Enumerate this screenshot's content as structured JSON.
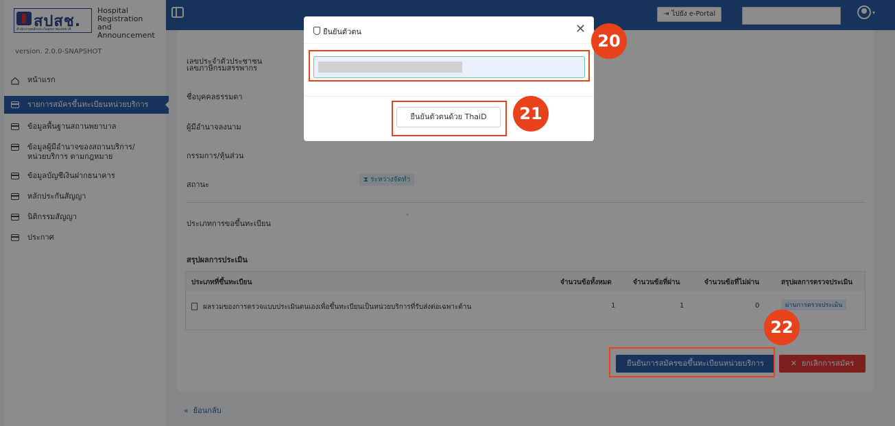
{
  "brand": {
    "logo_text": "สปสช.",
    "logo_subtitle": "สำนักงานหลักประกันสุขภาพแห่งชาติ",
    "name_line1": "Hospital",
    "name_line2": "Registration and",
    "name_line3": "Announcement",
    "version": "version. 2.0.0-SNAPSHOT"
  },
  "sidebar": {
    "items": [
      {
        "label": "หน้าแรก",
        "icon": "home-icon"
      },
      {
        "label": "รายการสมัครขึ้นทะเบียนหน่วยบริการ",
        "icon": "calendar-icon",
        "active": true
      },
      {
        "label": "ข้อมูลพื้นฐานสถานพยาบาล",
        "icon": "calendar-icon"
      },
      {
        "label": "ข้อมูลผู้มีอำนาจของสถานบริการ/หน่วยบริการ ตามกฎหมาย",
        "icon": "calendar-icon"
      },
      {
        "label": "ข้อมูลบัญชีเงินฝากธนาคาร",
        "icon": "calendar-icon"
      },
      {
        "label": "หลักประกันสัญญา",
        "icon": "calendar-icon"
      },
      {
        "label": "นิติกรรมสัญญา",
        "icon": "calendar-icon"
      },
      {
        "label": "ประกาศ",
        "icon": "calendar-icon"
      }
    ]
  },
  "topbar": {
    "portal_label": "ไปยัง e-Portal"
  },
  "form": {
    "fields": [
      "เลขประจำตัวประชาชน",
      "เลขภาษีกรมสรรพากร",
      "ชื่อบุคคลธรรมดา",
      "ผู้มีอำนาจลงนาม",
      "กรรมการ/หุ้นส่วน",
      "สถานะ"
    ],
    "status_value": "ระหว่างจัดทำ",
    "registration_type_label": "ประเภทการขอขึ้นทะเบียน",
    "registration_type_value": "-"
  },
  "summary": {
    "title": "สรุปผลการประเมิน",
    "columns": [
      "ประเภทที่ขึ้นทะเบียน",
      "จำนวนข้อทั้งหมด",
      "จำนวนข้อที่ผ่าน",
      "จำนวนข้อที่ไม่ผ่าน",
      "สรุปผลการตรวจประเมิน"
    ],
    "rows": [
      {
        "type": "ผลรวมของการตรวจแบบประเมินตนเองเพื่อขึ้นทะเบียนเป็นหน่วยบริการที่รับส่งต่อเฉพาะด้าน",
        "total": "1",
        "passed": "1",
        "failed": "0",
        "result": "ผ่านการตรวจประเมิน"
      }
    ]
  },
  "actions": {
    "confirm_label": "ยืนยันการสมัครขอขึ้นทะเบียนหน่วยบริการ",
    "cancel_label": "ยกเลิกการสมัคร",
    "back_label": "ย้อนกลับ"
  },
  "modal": {
    "title": "ยืนยันตัวตน",
    "thaid_label": "ยืนยันตัวตนด้วย ThaiD"
  },
  "annotations": [
    "20",
    "21",
    "22"
  ],
  "colors": {
    "primary": "#2a5ea8",
    "danger": "#e53a3a",
    "highlight": "#e8421c"
  }
}
